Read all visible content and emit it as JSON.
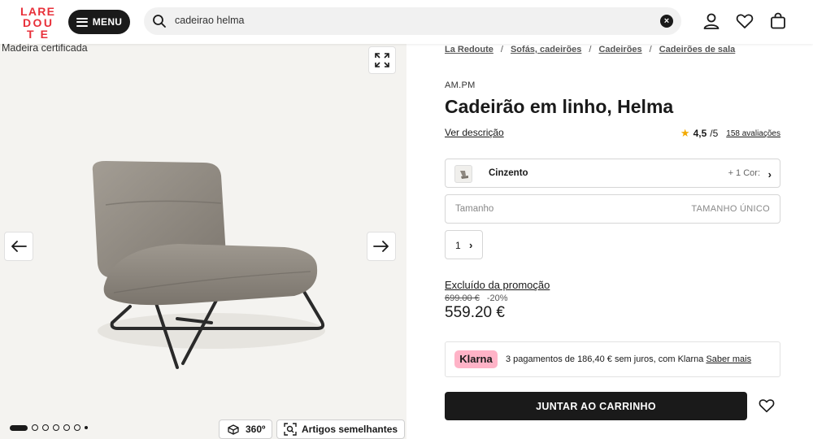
{
  "header": {
    "logo_text": [
      "LARE",
      "DOU",
      "TE"
    ],
    "menu_label": "MENU",
    "search_value": "cadeirao helma",
    "icons": [
      "search-icon",
      "clear-icon",
      "account-icon",
      "heart-icon",
      "bag-icon"
    ]
  },
  "gallery": {
    "badge": "Madeira certificada",
    "view_360_label": "360º",
    "similar_label": "Artigos semelhantes",
    "dot_count": 7
  },
  "product": {
    "breadcrumbs": [
      "La Redoute",
      "Sofás, cadeirões",
      "Cadeirões",
      "Cadeirões de sala"
    ],
    "brand": "AM.PM",
    "title": "Cadeirão em linho, Helma",
    "description_link": "Ver descrição",
    "rating": {
      "score": "4,5",
      "out_of": "/5",
      "reviews": "158 avaliações"
    },
    "color": {
      "name": "Cinzento",
      "more": "+ 1 Cor:"
    },
    "size": {
      "label": "Tamanho",
      "value": "TAMANHO ÚNICO"
    },
    "quantity": "1",
    "promo_note": "Excluído da promoção",
    "old_price": "699.00 €",
    "discount": "-20%",
    "price": "559.20 €",
    "klarna": {
      "logo": "Klarna",
      "text": "3 pagamentos de 186,40 € sem juros, com Klarna",
      "link": "Saber mais"
    },
    "cart_button": "JUNTAR AO CARRINHO"
  },
  "colors": {
    "logo": "#e8303a",
    "dark": "#1a1a1a",
    "klarna": "#ffb3c7",
    "star": "#f2a900"
  }
}
